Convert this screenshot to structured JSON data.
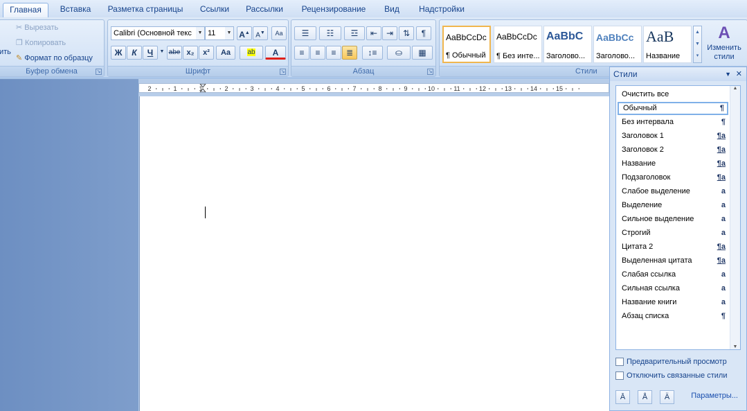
{
  "tabs": [
    {
      "label": "Главная",
      "active": true
    },
    {
      "label": "Вставка"
    },
    {
      "label": "Разметка страницы"
    },
    {
      "label": "Ссылки"
    },
    {
      "label": "Рассылки"
    },
    {
      "label": "Рецензирование"
    },
    {
      "label": "Вид"
    },
    {
      "label": "Надстройки"
    }
  ],
  "clipboard": {
    "paste_label": "ить",
    "cut": "Вырезать",
    "copy": "Копировать",
    "format_painter": "Формат по образцу",
    "group_label": "Буфер обмена"
  },
  "font": {
    "font_name": "Calibri (Основной текс",
    "font_size": "11",
    "grow_glyph": "A",
    "shrink_glyph": "A",
    "bold": "Ж",
    "italic": "К",
    "underline": "Ч",
    "strike": "abe",
    "subscript": "x₂",
    "superscript": "x²",
    "case": "Aa",
    "highlight": "ab",
    "color": "A",
    "group_label": "Шрифт"
  },
  "paragraph": {
    "show_marks": "¶",
    "group_label": "Абзац"
  },
  "styles_gallery": {
    "items": [
      {
        "preview": "AaBbCcDc",
        "name": "¶ Обычный",
        "selected": true
      },
      {
        "preview": "AaBbCcDc",
        "name": "¶ Без инте..."
      },
      {
        "preview": "AaBbC",
        "name": "Заголово..."
      },
      {
        "preview": "AaBbCc",
        "name": "Заголово..."
      },
      {
        "preview": "AaB",
        "name": "Название"
      }
    ],
    "change_styles": "Изменить стили",
    "group_label": "Стили"
  },
  "ruler": {
    "ticks": [
      "2",
      "1",
      "1",
      "2",
      "3",
      "4",
      "5",
      "6",
      "7",
      "8",
      "9",
      "10",
      "11",
      "12",
      "13",
      "14",
      "15"
    ]
  },
  "styles_pane": {
    "title": "Стили",
    "items": [
      {
        "label": "Очистить все",
        "mark": ""
      },
      {
        "label": "Обычный",
        "mark": "¶",
        "selected": true
      },
      {
        "label": "Без интервала",
        "mark": "¶"
      },
      {
        "label": "Заголовок 1",
        "mark": "¶a"
      },
      {
        "label": "Заголовок 2",
        "mark": "¶a"
      },
      {
        "label": "Название",
        "mark": "¶a"
      },
      {
        "label": "Подзаголовок",
        "mark": "¶a"
      },
      {
        "label": "Слабое выделение",
        "mark": "a"
      },
      {
        "label": "Выделение",
        "mark": "a"
      },
      {
        "label": "Сильное выделение",
        "mark": "a"
      },
      {
        "label": "Строгий",
        "mark": "a"
      },
      {
        "label": "Цитата 2",
        "mark": "¶a"
      },
      {
        "label": "Выделенная цитата",
        "mark": "¶a"
      },
      {
        "label": "Слабая ссылка",
        "mark": "a"
      },
      {
        "label": "Сильная ссылка",
        "mark": "a"
      },
      {
        "label": "Название книги",
        "mark": "a"
      },
      {
        "label": "Абзац списка",
        "mark": "¶"
      }
    ],
    "preview_label": "Предварительный просмотр",
    "linked_label": "Отключить связанные стили",
    "params_link": "Параметры..."
  }
}
